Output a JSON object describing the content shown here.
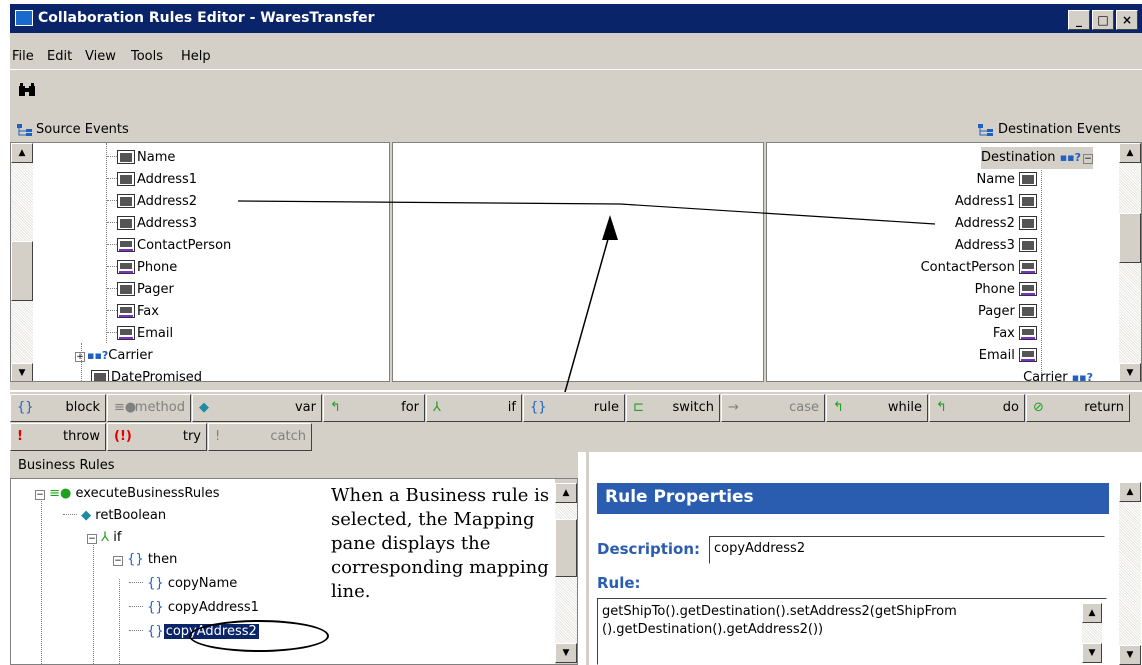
{
  "window": {
    "title": "Collaboration Rules Editor - WaresTransfer",
    "buttons": [
      "_",
      "□",
      "×"
    ]
  },
  "menu": [
    "File",
    "Edit",
    "View",
    "Tools",
    "Help"
  ],
  "source_pane": {
    "header": "Source Events",
    "items": [
      "Name",
      "Address1",
      "Address2",
      "Address3",
      "ContactPerson",
      "Phone",
      "Pager",
      "Fax",
      "Email",
      "Carrier",
      "DatePromised"
    ]
  },
  "destination_pane": {
    "header": "Destination Events",
    "items": [
      "Destination",
      "Name",
      "Address1",
      "Address2",
      "Address3",
      "ContactPerson",
      "Phone",
      "Pager",
      "Fax",
      "Email",
      "Carrier"
    ]
  },
  "rule_buttons": [
    {
      "label": "block",
      "icon": "{}"
    },
    {
      "label": "method",
      "icon": "≡●"
    },
    {
      "label": "var",
      "icon": "◆"
    },
    {
      "label": "for",
      "icon": "↰"
    },
    {
      "label": "if",
      "icon": "⅄"
    },
    {
      "label": "rule",
      "icon": "{}"
    },
    {
      "label": "switch",
      "icon": "⊏"
    },
    {
      "label": "case",
      "icon": "→"
    },
    {
      "label": "while",
      "icon": "↰"
    },
    {
      "label": "do",
      "icon": "↰"
    },
    {
      "label": "return",
      "icon": "⊘"
    },
    {
      "label": "throw",
      "icon": "!"
    },
    {
      "label": "try",
      "icon": "(!)"
    },
    {
      "label": "catch",
      "icon": "!"
    }
  ],
  "business_rules": {
    "header": "Business Rules",
    "items": [
      "executeBusinessRules",
      "retBoolean",
      "if",
      "then",
      "copyName",
      "copyAddress1",
      "copyAddress2"
    ]
  },
  "callout_text": "When a Business rule is selected, the Mapping pane displays the corresponding mapping line.",
  "rule_properties": {
    "title": "Rule Properties",
    "description_label": "Description:",
    "description_value": "copyAddress2",
    "rule_label": "Rule:",
    "rule_text": "getShipTo().getDestination().setAddress2(getShipFrom ().getDestination().getAddress2())"
  }
}
